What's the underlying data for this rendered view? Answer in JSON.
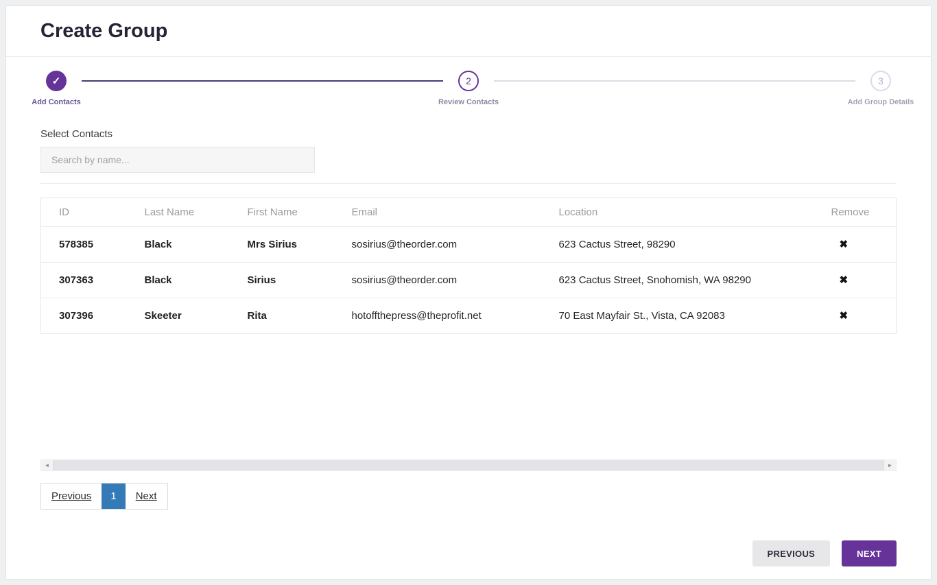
{
  "page": {
    "title": "Create Group"
  },
  "stepper": {
    "steps": [
      {
        "number": "1",
        "label": "Add Contacts",
        "state": "complete"
      },
      {
        "number": "2",
        "label": "Review Contacts",
        "state": "current"
      },
      {
        "number": "3",
        "label": "Add Group Details",
        "state": "upcoming"
      }
    ]
  },
  "contacts": {
    "section_label": "Select Contacts",
    "search_placeholder": "Search by name...",
    "table": {
      "columns": [
        "ID",
        "Last Name",
        "First Name",
        "Email",
        "Location",
        "Remove"
      ],
      "remove_icon": "✖",
      "rows": [
        {
          "id": "578385",
          "last_name": "Black",
          "first_name": "Mrs Sirius",
          "email": "sosirius@theorder.com",
          "location": "623 Cactus Street, 98290"
        },
        {
          "id": "307363",
          "last_name": "Black",
          "first_name": "Sirius",
          "email": "sosirius@theorder.com",
          "location": "623 Cactus Street, Snohomish, WA 98290"
        },
        {
          "id": "307396",
          "last_name": "Skeeter",
          "first_name": "Rita",
          "email": "hotoffthepress@theprofit.net",
          "location": "70 East Mayfair St., Vista, CA 92083"
        }
      ]
    },
    "pagination": {
      "previous": "Previous",
      "current_page": "1",
      "next": "Next"
    }
  },
  "footer": {
    "previous_label": "PREVIOUS",
    "next_label": "NEXT"
  },
  "colors": {
    "primary": "#663399",
    "pagination_active": "#337ab7",
    "connector_done": "#463a77"
  }
}
